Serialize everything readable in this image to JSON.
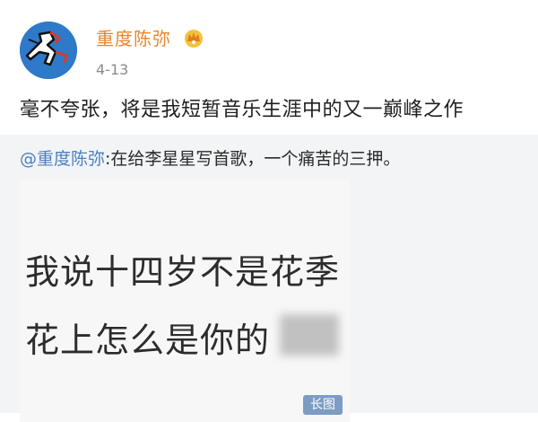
{
  "post": {
    "username": "重度陈弥",
    "date": "4-13",
    "content": "毫不夸张，将是我短暂音乐生涯中的又一巅峰之作"
  },
  "repost": {
    "mention": "@重度陈弥",
    "text": ":在给李星星写首歌，一个痛苦的三押。",
    "image": {
      "line1": "我说十四岁不是花季",
      "line2": "花上怎么是你的",
      "badge": "长图"
    }
  },
  "colors": {
    "username": "#e8862e",
    "mention": "#4b7fc4",
    "repost_bg": "#f3f4f6",
    "badge_bg": "#7d9cc4"
  },
  "icons": [
    "avatar",
    "vip-crown-icon"
  ]
}
